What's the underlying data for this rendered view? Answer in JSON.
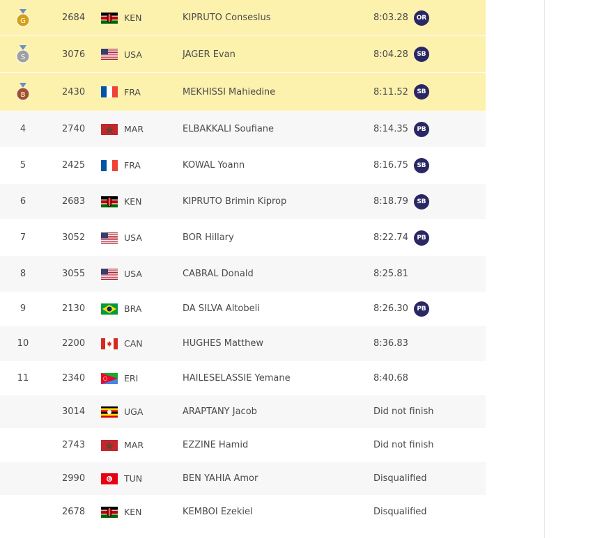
{
  "results": [
    {
      "rank": "",
      "medal": "G",
      "medal_color": "#d4a017",
      "bib": "2684",
      "flag": "ken-flag",
      "noc": "KEN",
      "name": "KIPRUTO Conseslus",
      "result": "8:03.28",
      "record": "OR"
    },
    {
      "rank": "",
      "medal": "S",
      "medal_color": "#a0a0a0",
      "bib": "3076",
      "flag": "usa-flag",
      "noc": "USA",
      "name": "JAGER Evan",
      "result": "8:04.28",
      "record": "SB"
    },
    {
      "rank": "",
      "medal": "B",
      "medal_color": "#a0522d",
      "bib": "2430",
      "flag": "fra-flag",
      "noc": "FRA",
      "name": "MEKHISSI Mahiedine",
      "result": "8:11.52",
      "record": "SB"
    },
    {
      "rank": "4",
      "medal": "",
      "bib": "2740",
      "flag": "mar-flag",
      "noc": "MAR",
      "name": "ELBAKKALI Soufiane",
      "result": "8:14.35",
      "record": "PB"
    },
    {
      "rank": "5",
      "medal": "",
      "bib": "2425",
      "flag": "fra-flag",
      "noc": "FRA",
      "name": "KOWAL Yoann",
      "result": "8:16.75",
      "record": "SB"
    },
    {
      "rank": "6",
      "medal": "",
      "bib": "2683",
      "flag": "ken-flag",
      "noc": "KEN",
      "name": "KIPRUTO Brimin Kiprop",
      "result": "8:18.79",
      "record": "SB"
    },
    {
      "rank": "7",
      "medal": "",
      "bib": "3052",
      "flag": "usa-flag",
      "noc": "USA",
      "name": "BOR Hillary",
      "result": "8:22.74",
      "record": "PB"
    },
    {
      "rank": "8",
      "medal": "",
      "bib": "3055",
      "flag": "usa-flag",
      "noc": "USA",
      "name": "CABRAL Donald",
      "result": "8:25.81",
      "record": ""
    },
    {
      "rank": "9",
      "medal": "",
      "bib": "2130",
      "flag": "bra-flag",
      "noc": "BRA",
      "name": "DA SILVA Altobeli",
      "result": "8:26.30",
      "record": "PB"
    },
    {
      "rank": "10",
      "medal": "",
      "bib": "2200",
      "flag": "can-flag",
      "noc": "CAN",
      "name": "HUGHES Matthew",
      "result": "8:36.83",
      "record": ""
    },
    {
      "rank": "11",
      "medal": "",
      "bib": "2340",
      "flag": "eri-flag",
      "noc": "ERI",
      "name": "HAILESELASSIE Yemane",
      "result": "8:40.68",
      "record": ""
    },
    {
      "rank": "",
      "medal": "",
      "bib": "3014",
      "flag": "uga-flag",
      "noc": "UGA",
      "name": "ARAPTANY Jacob",
      "result": "Did not finish",
      "record": ""
    },
    {
      "rank": "",
      "medal": "",
      "bib": "2743",
      "flag": "mar-flag",
      "noc": "MAR",
      "name": "EZZINE Hamid",
      "result": "Did not finish",
      "record": ""
    },
    {
      "rank": "",
      "medal": "",
      "bib": "2990",
      "flag": "tun-flag",
      "noc": "TUN",
      "name": "BEN YAHIA Amor",
      "result": "Disqualified",
      "record": ""
    },
    {
      "rank": "",
      "medal": "",
      "bib": "2678",
      "flag": "ken-flag",
      "noc": "KEN",
      "name": "KEMBOI Ezekiel",
      "result": "Disqualified",
      "record": ""
    }
  ]
}
